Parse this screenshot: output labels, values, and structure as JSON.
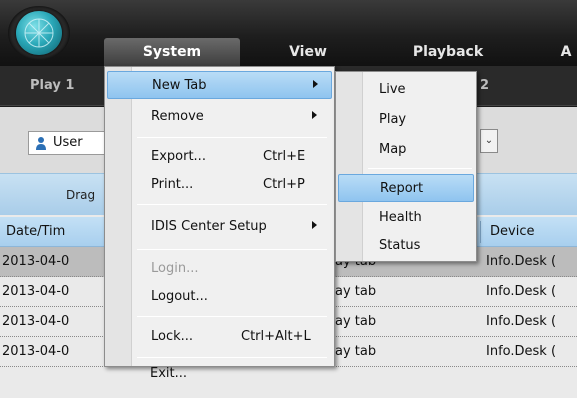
{
  "menubar": {
    "items": [
      {
        "label": "System"
      },
      {
        "label": "View"
      },
      {
        "label": "Playback"
      },
      {
        "label": "A"
      }
    ]
  },
  "tabs": [
    {
      "label": "Play 1"
    },
    {
      "label": "2"
    }
  ],
  "filter": {
    "user_label": "User",
    "dropdown_glyph": "⌄"
  },
  "drag_hint": "Drag",
  "table": {
    "headers": [
      "Date/Tim",
      "Device"
    ],
    "rows": [
      {
        "date": "2013-04-0",
        "desc": "ay tab",
        "device": "Info.Desk ("
      },
      {
        "date": "2013-04-0",
        "desc": "ay tab",
        "device": "Info.Desk ("
      },
      {
        "date": "2013-04-0",
        "desc": "ay tab",
        "device": "Info.Desk ("
      },
      {
        "date": "2013-04-0",
        "desc": "ay tab",
        "device": "Info.Desk ("
      }
    ]
  },
  "system_menu": {
    "items": [
      {
        "label": "New Tab",
        "shortcut": ""
      },
      {
        "label": "Remove",
        "shortcut": ""
      },
      {
        "label": "Export...",
        "shortcut": "Ctrl+E"
      },
      {
        "label": "Print...",
        "shortcut": "Ctrl+P"
      },
      {
        "label": "IDIS Center Setup",
        "shortcut": ""
      },
      {
        "label": "Login...",
        "shortcut": ""
      },
      {
        "label": "Logout...",
        "shortcut": ""
      },
      {
        "label": "Lock...",
        "shortcut": "Ctrl+Alt+L"
      },
      {
        "label": "Exit...",
        "shortcut": ""
      }
    ]
  },
  "new_tab_submenu": {
    "items": [
      {
        "label": "Live"
      },
      {
        "label": "Play"
      },
      {
        "label": "Map"
      },
      {
        "label": "Report"
      },
      {
        "label": "Health"
      },
      {
        "label": "Status"
      }
    ]
  },
  "colors": {
    "highlight": "#9fcdf2",
    "header_blue": "#b3d6f0",
    "logo": "#2aa8b8"
  }
}
